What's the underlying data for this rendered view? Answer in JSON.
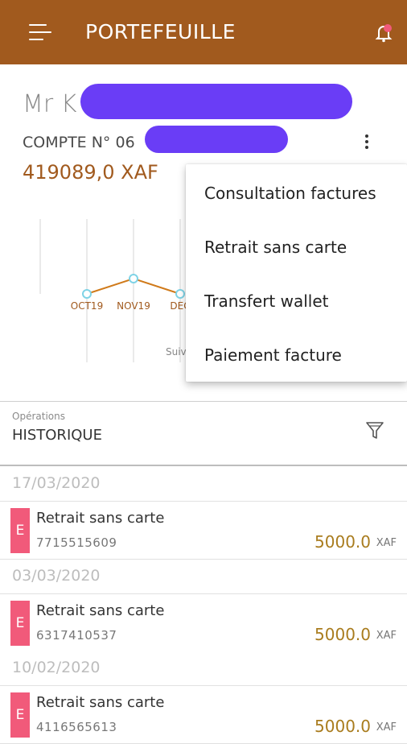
{
  "header": {
    "title": "PORTEFEUILLE"
  },
  "account": {
    "owner_prefix": "Mr K",
    "account_label": "COMPTE N° 06",
    "balance": "419089,0 XAF"
  },
  "chart_data": {
    "type": "line",
    "categories": [
      "OCT19",
      "NOV19",
      "DEC"
    ],
    "values": [
      null,
      null,
      null
    ],
    "caption": "Suiv",
    "color": "#d07a1a"
  },
  "overflow_menu": {
    "items": [
      {
        "label": "Consultation factures"
      },
      {
        "label": "Retrait sans carte"
      },
      {
        "label": "Transfert wallet"
      },
      {
        "label": "Paiement facture"
      }
    ]
  },
  "operations": {
    "small_label": "Opérations",
    "title": "HISTORIQUE"
  },
  "history": [
    {
      "date": "17/03/2020",
      "badge": "E",
      "name": "Retrait sans carte",
      "reference": "7715515609",
      "amount": "5000.0",
      "currency": "XAF"
    },
    {
      "date": "03/03/2020",
      "badge": "E",
      "name": "Retrait sans carte",
      "reference": "6317410537",
      "amount": "5000.0",
      "currency": "XAF"
    },
    {
      "date": "10/02/2020",
      "badge": "E",
      "name": "Retrait sans carte",
      "reference": "4116565613",
      "amount": "5000.0",
      "currency": "XAF"
    }
  ],
  "colors": {
    "appbar": "#a15a1e",
    "balance": "#a15a1e",
    "amount": "#a97c1e",
    "badge": "#f15a7a",
    "redaction": "#6a3df6"
  },
  "icons": {
    "menu": "hamburger-icon",
    "notifications": "notification-bell-icon",
    "more": "more-vertical-icon",
    "filter": "filter-funnel-icon"
  }
}
